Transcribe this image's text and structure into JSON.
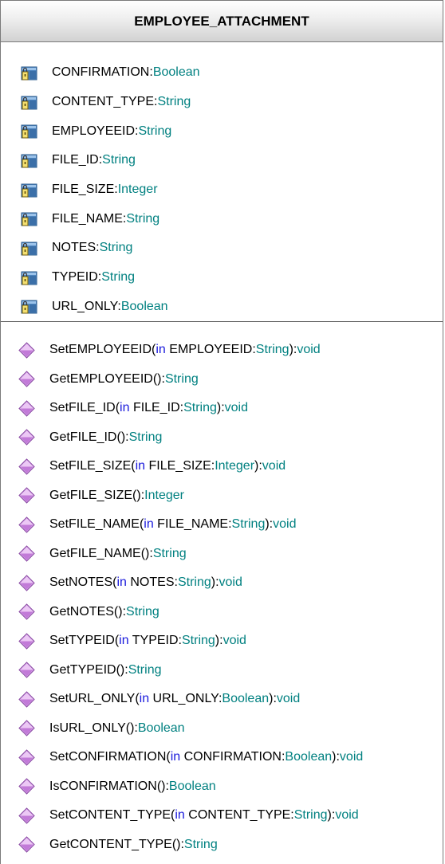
{
  "class_name": "EMPLOYEE_ATTACHMENT",
  "attributes": [
    {
      "name": "CONFIRMATION",
      "type": "Boolean"
    },
    {
      "name": "CONTENT_TYPE",
      "type": "String"
    },
    {
      "name": "EMPLOYEEID",
      "type": "String"
    },
    {
      "name": "FILE_ID",
      "type": "String"
    },
    {
      "name": "FILE_SIZE",
      "type": "Integer"
    },
    {
      "name": "FILE_NAME",
      "type": "String"
    },
    {
      "name": "NOTES",
      "type": "String"
    },
    {
      "name": "TYPEID",
      "type": "String"
    },
    {
      "name": "URL_ONLY",
      "type": "Boolean"
    }
  ],
  "operations": [
    {
      "name": "SetEMPLOYEEID",
      "param_dir": "in",
      "param_name": "EMPLOYEEID",
      "param_type": "String",
      "return_type": "void"
    },
    {
      "name": "GetEMPLOYEEID",
      "return_type": "String"
    },
    {
      "name": "SetFILE_ID",
      "param_dir": "in",
      "param_name": "FILE_ID",
      "param_type": "String",
      "return_type": "void"
    },
    {
      "name": "GetFILE_ID",
      "return_type": "String"
    },
    {
      "name": "SetFILE_SIZE",
      "param_dir": "in",
      "param_name": "FILE_SIZE",
      "param_type": "Integer",
      "return_type": "void"
    },
    {
      "name": "GetFILE_SIZE",
      "return_type": "Integer"
    },
    {
      "name": "SetFILE_NAME",
      "param_dir": "in",
      "param_name": "FILE_NAME",
      "param_type": "String",
      "return_type": "void"
    },
    {
      "name": "GetFILE_NAME",
      "return_type": "String"
    },
    {
      "name": "SetNOTES",
      "param_dir": "in",
      "param_name": "NOTES",
      "param_type": "String",
      "return_type": "void"
    },
    {
      "name": "GetNOTES",
      "return_type": "String"
    },
    {
      "name": "SetTYPEID",
      "param_dir": "in",
      "param_name": "TYPEID",
      "param_type": "String",
      "return_type": "void"
    },
    {
      "name": "GetTYPEID",
      "return_type": "String"
    },
    {
      "name": "SetURL_ONLY",
      "param_dir": "in",
      "param_name": "URL_ONLY",
      "param_type": "Boolean",
      "return_type": "void"
    },
    {
      "name": "IsURL_ONLY",
      "return_type": "Boolean"
    },
    {
      "name": "SetCONFIRMATION",
      "param_dir": "in",
      "param_name": "CONFIRMATION",
      "param_type": "Boolean",
      "return_type": "void"
    },
    {
      "name": "IsCONFIRMATION",
      "return_type": "Boolean"
    },
    {
      "name": "SetCONTENT_TYPE",
      "param_dir": "in",
      "param_name": "CONTENT_TYPE",
      "param_type": "String",
      "return_type": "void"
    },
    {
      "name": "GetCONTENT_TYPE",
      "return_type": "String"
    }
  ],
  "icons": {
    "attribute": "private-attribute-icon",
    "operation": "public-operation-icon"
  },
  "colors": {
    "type": "#008080",
    "keyword": "#1a1adc",
    "name": "#000000",
    "operation_icon": "#d6a0e6",
    "attribute_icon": "#5b8fc7"
  }
}
